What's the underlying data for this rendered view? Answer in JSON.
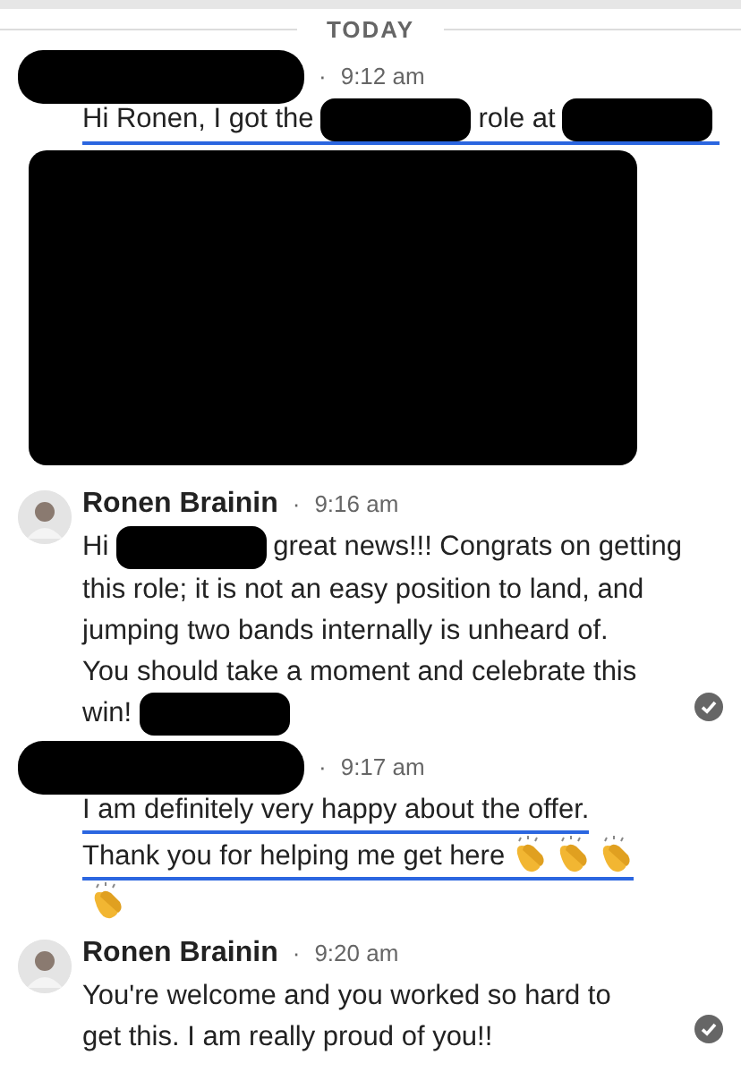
{
  "divider": {
    "label": "TODAY"
  },
  "messages": [
    {
      "sender_redacted": true,
      "separator": "·",
      "time": "9:12 am",
      "read": false,
      "lines": [
        {
          "underlined": true,
          "parts": [
            {
              "kind": "text",
              "text": "Hi Ronen, I got the"
            },
            {
              "kind": "redacted"
            },
            {
              "kind": "text",
              "text": "role at"
            },
            {
              "kind": "redacted"
            }
          ]
        },
        {
          "underlined": false,
          "parts": [
            {
              "kind": "redacted-block"
            }
          ]
        }
      ]
    },
    {
      "sender": "Ronen Brainin",
      "avatar": true,
      "separator": "·",
      "time": "9:16 am",
      "read": true,
      "lines": [
        {
          "underlined": false,
          "parts": [
            {
              "kind": "text",
              "text": "Hi"
            },
            {
              "kind": "redacted"
            },
            {
              "kind": "text",
              "text": "great news!!! Congrats on getting"
            }
          ]
        },
        {
          "underlined": false,
          "parts": [
            {
              "kind": "text",
              "text": "this role; it is not an easy position to land, and"
            }
          ]
        },
        {
          "underlined": false,
          "parts": [
            {
              "kind": "text",
              "text": "jumping two bands internally is unheard of."
            }
          ]
        },
        {
          "underlined": false,
          "parts": [
            {
              "kind": "text",
              "text": "You should take a moment and celebrate this"
            }
          ]
        },
        {
          "underlined": false,
          "parts": [
            {
              "kind": "text",
              "text": "win!"
            },
            {
              "kind": "redacted"
            }
          ]
        }
      ]
    },
    {
      "sender_redacted": true,
      "separator": "·",
      "time": "9:17 am",
      "read": false,
      "lines": [
        {
          "underlined": true,
          "parts": [
            {
              "kind": "text",
              "text": "I am definitely very happy about the offer."
            }
          ]
        },
        {
          "underlined": true,
          "parts": [
            {
              "kind": "text",
              "text": "Thank you for helping me get here"
            },
            {
              "kind": "clap"
            },
            {
              "kind": "clap"
            },
            {
              "kind": "clap"
            }
          ]
        },
        {
          "underlined": false,
          "parts": [
            {
              "kind": "clap"
            }
          ]
        }
      ]
    },
    {
      "sender": "Ronen Brainin",
      "avatar": true,
      "separator": "·",
      "time": "9:20 am",
      "read": true,
      "lines": [
        {
          "underlined": false,
          "parts": [
            {
              "kind": "text",
              "text": "You're welcome and you worked so hard to"
            }
          ]
        },
        {
          "underlined": false,
          "parts": [
            {
              "kind": "text",
              "text": "get this. I am really proud of you!!"
            }
          ]
        }
      ]
    }
  ]
}
